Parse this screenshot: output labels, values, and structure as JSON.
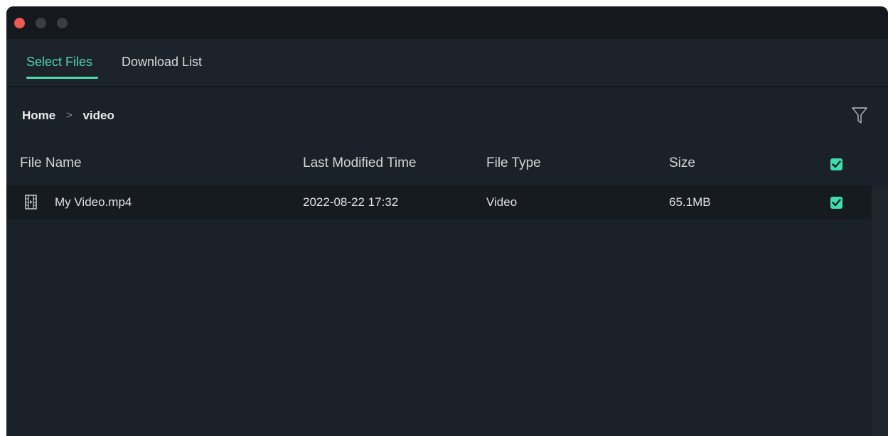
{
  "window": {
    "traffic_lights": [
      "close",
      "minimize",
      "maximize"
    ]
  },
  "tabs": [
    {
      "label": "Select Files",
      "active": true
    },
    {
      "label": "Download List",
      "active": false
    }
  ],
  "breadcrumb": {
    "items": [
      "Home",
      "video"
    ],
    "separator": ">"
  },
  "toolbar": {
    "filter_icon": "filter-icon"
  },
  "table": {
    "columns": [
      "File Name",
      "Last Modified Time",
      "File Type",
      "Size"
    ],
    "select_all_checked": true,
    "rows": [
      {
        "icon": "video-file-icon",
        "name": "My Video.mp4",
        "modified": "2022-08-22 17:32",
        "type": "Video",
        "size": "65.1MB",
        "checked": true
      }
    ]
  },
  "colors": {
    "accent": "#4fd6b1",
    "checkbox": "#3fdcb2",
    "background": "#1b2128",
    "close_button": "#ee5a52"
  }
}
